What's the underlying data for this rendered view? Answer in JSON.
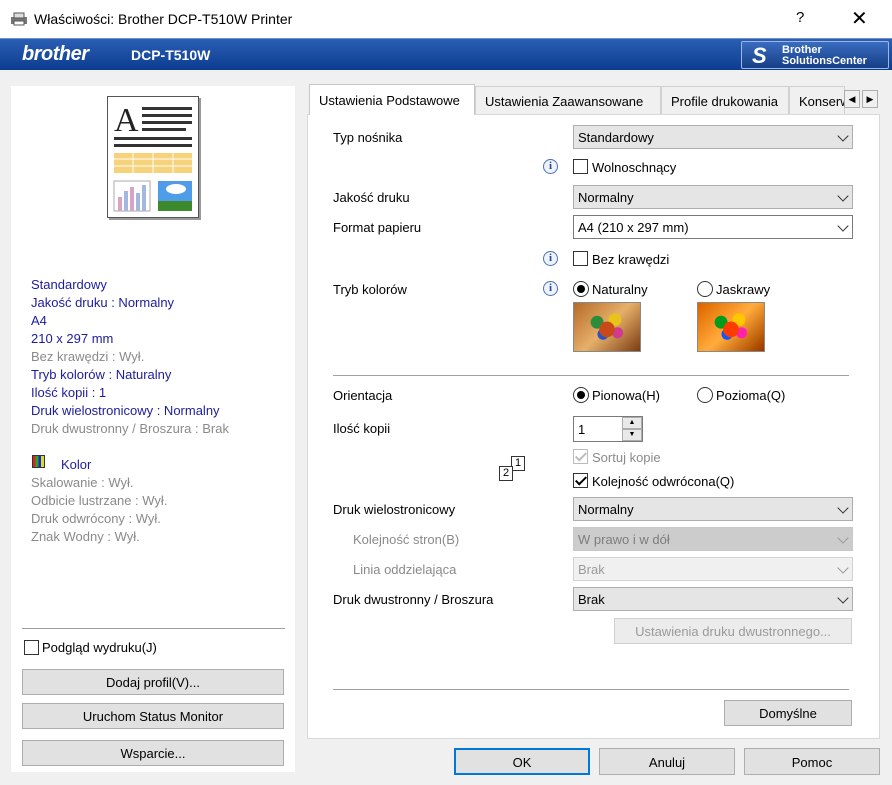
{
  "window": {
    "title": "Właściwości: Brother DCP-T510W Printer",
    "help_label": "?",
    "close_label": "✕"
  },
  "banner": {
    "logo": "brother",
    "model": "DCP-T510W",
    "solutions_center": {
      "line1": "Brother",
      "line2": "SolutionsCenter"
    }
  },
  "summary": {
    "lines": [
      {
        "text": "Standardowy",
        "style": "blue"
      },
      {
        "text": "Jakość druku : Normalny",
        "style": "blue"
      },
      {
        "text": "A4",
        "style": "blue"
      },
      {
        "text": "210 x 297 mm",
        "style": "blue"
      },
      {
        "text": "Bez krawędzi : Wył.",
        "style": "gray"
      },
      {
        "text": "Tryb kolorów : Naturalny",
        "style": "blue"
      },
      {
        "text": "Ilość kopii : 1",
        "style": "blue"
      },
      {
        "text": "Druk wielostronicowy  : Normalny",
        "style": "blue"
      },
      {
        "text": "Druk dwustronny / Broszura : Brak",
        "style": "gray"
      }
    ],
    "color_label": "Kolor",
    "extra_lines": [
      "Skalowanie : Wył.",
      "Odbicie lustrzane : Wył.",
      "Druk odwrócony : Wył.",
      "Znak Wodny : Wył."
    ]
  },
  "left_actions": {
    "preview_checkbox_label": "Podgląd wydruku(J)",
    "preview_checked": false,
    "add_profile": "Dodaj profil(V)...",
    "status_monitor": "Uruchom Status Monitor",
    "support": "Wsparcie..."
  },
  "tabs": [
    {
      "label": "Ustawienia Podstawowe",
      "active": true
    },
    {
      "label": "Ustawienia Zaawansowane",
      "active": false
    },
    {
      "label": "Profile drukowania",
      "active": false
    },
    {
      "label": "Konserwacja",
      "active": false
    }
  ],
  "tab_arrows": {
    "left": "◀",
    "right": "▶"
  },
  "form": {
    "media_type": {
      "label": "Typ nośnika",
      "value": "Standardowy"
    },
    "slow_drying": {
      "label": "Wolnoschnący",
      "checked": false
    },
    "print_quality": {
      "label": "Jakość druku",
      "value": "Normalny"
    },
    "paper_size": {
      "label": "Format papieru",
      "value": "A4 (210 x 297 mm)"
    },
    "borderless": {
      "label": "Bez krawędzi",
      "checked": false
    },
    "color_mode": {
      "label": "Tryb kolorów",
      "options": [
        "Naturalny",
        "Jaskrawy"
      ],
      "selected": "Naturalny"
    },
    "orientation": {
      "label": "Orientacja",
      "options": [
        "Pionowa(H)",
        "Pozioma(Q)"
      ],
      "selected": "Pionowa(H)"
    },
    "copies": {
      "label": "Ilość kopii",
      "value": "1"
    },
    "collate": {
      "label": "Sortuj kopie",
      "checked": true,
      "disabled": true
    },
    "reverse_order": {
      "label": "Kolejność odwrócona(Q)",
      "checked": true
    },
    "multiple_page": {
      "label": "Druk wielostronicowy",
      "value": "Normalny"
    },
    "page_order": {
      "label": "Kolejność stron(B)",
      "value": "W prawo i w dół"
    },
    "border_line": {
      "label": "Linia oddzielająca",
      "value": "Brak"
    },
    "duplex": {
      "label": "Druk dwustronny / Broszura",
      "value": "Brak"
    },
    "duplex_settings_button": "Ustawienia druku dwustronnego...",
    "default_button": "Domyślne"
  },
  "collate_icon": {
    "front": "2",
    "back": "1"
  },
  "info_glyph": "i",
  "spin_glyphs": {
    "up": "▲",
    "down": "▼"
  },
  "dialog_buttons": {
    "ok": "OK",
    "cancel": "Anuluj",
    "help": "Pomoc"
  }
}
